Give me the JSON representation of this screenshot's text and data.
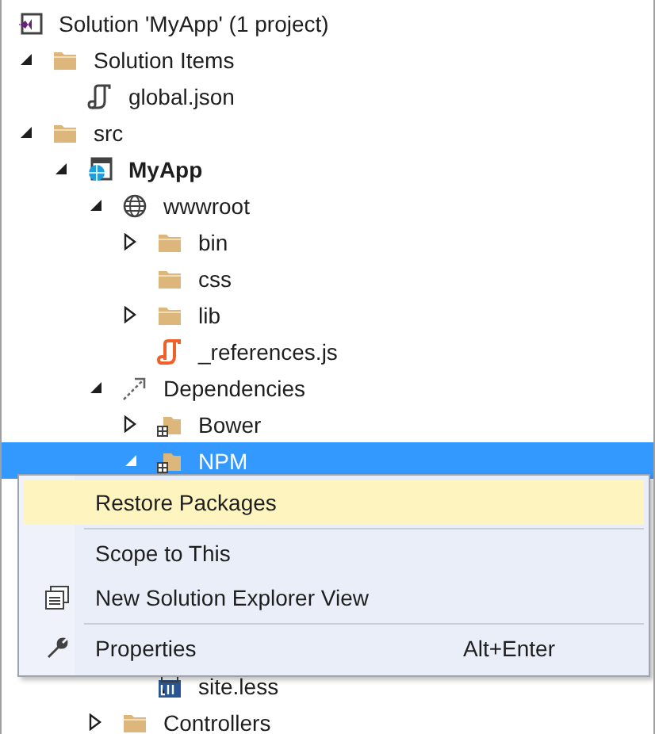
{
  "tree": [
    {
      "label": "Solution 'MyApp' (1 project)",
      "kind": "solution",
      "selected": false,
      "children": [
        {
          "label": "Solution Items",
          "kind": "folder",
          "expanded": true,
          "selected": false,
          "children": [
            {
              "label": "global.json",
              "kind": "json",
              "selected": false
            }
          ]
        },
        {
          "label": "src",
          "kind": "folder",
          "expanded": true,
          "selected": false,
          "children": [
            {
              "label": "MyApp",
              "kind": "project",
              "bold": true,
              "expanded": true,
              "selected": false,
              "children": [
                {
                  "label": "wwwroot",
                  "kind": "globe",
                  "expanded": true,
                  "selected": false,
                  "children": [
                    {
                      "label": "bin",
                      "kind": "folder",
                      "expanded": false,
                      "selected": false
                    },
                    {
                      "label": "css",
                      "kind": "folder",
                      "selected": false
                    },
                    {
                      "label": "lib",
                      "kind": "folder",
                      "expanded": false,
                      "selected": false
                    },
                    {
                      "label": "_references.js",
                      "kind": "js",
                      "selected": false
                    }
                  ]
                },
                {
                  "label": "Dependencies",
                  "kind": "dependencies",
                  "expanded": true,
                  "selected": false,
                  "children": [
                    {
                      "label": "Bower",
                      "kind": "package",
                      "expanded": false,
                      "selected": false
                    },
                    {
                      "label": "NPM",
                      "kind": "package",
                      "expanded": true,
                      "selected": true
                    },
                    {
                      "label": "site.less",
                      "kind": "less",
                      "selected": false
                    }
                  ]
                },
                {
                  "label": "Controllers",
                  "kind": "folder",
                  "expanded": false,
                  "selected": false
                }
              ]
            }
          ]
        }
      ]
    }
  ],
  "context_menu": {
    "items": [
      {
        "kind": "plain",
        "label": "Restore Packages",
        "selected": true
      },
      {
        "kind": "separator"
      },
      {
        "kind": "plain",
        "label": "Scope to This",
        "selected": false
      },
      {
        "kind": "windows",
        "label": "New Solution Explorer View",
        "selected": false
      },
      {
        "kind": "separator"
      },
      {
        "kind": "wrench",
        "label": "Properties",
        "shortcut": "Alt+Enter",
        "selected": false
      }
    ]
  }
}
